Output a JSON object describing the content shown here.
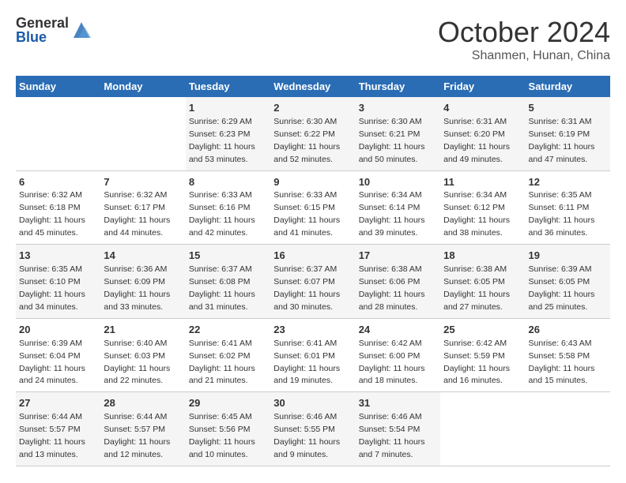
{
  "header": {
    "logo_general": "General",
    "logo_blue": "Blue",
    "title": "October 2024",
    "location": "Shanmen, Hunan, China"
  },
  "days_of_week": [
    "Sunday",
    "Monday",
    "Tuesday",
    "Wednesday",
    "Thursday",
    "Friday",
    "Saturday"
  ],
  "weeks": [
    [
      {
        "day": "",
        "info": ""
      },
      {
        "day": "",
        "info": ""
      },
      {
        "day": "1",
        "sunrise": "6:29 AM",
        "sunset": "6:23 PM",
        "daylight": "11 hours and 53 minutes."
      },
      {
        "day": "2",
        "sunrise": "6:30 AM",
        "sunset": "6:22 PM",
        "daylight": "11 hours and 52 minutes."
      },
      {
        "day": "3",
        "sunrise": "6:30 AM",
        "sunset": "6:21 PM",
        "daylight": "11 hours and 50 minutes."
      },
      {
        "day": "4",
        "sunrise": "6:31 AM",
        "sunset": "6:20 PM",
        "daylight": "11 hours and 49 minutes."
      },
      {
        "day": "5",
        "sunrise": "6:31 AM",
        "sunset": "6:19 PM",
        "daylight": "11 hours and 47 minutes."
      }
    ],
    [
      {
        "day": "6",
        "sunrise": "6:32 AM",
        "sunset": "6:18 PM",
        "daylight": "11 hours and 45 minutes."
      },
      {
        "day": "7",
        "sunrise": "6:32 AM",
        "sunset": "6:17 PM",
        "daylight": "11 hours and 44 minutes."
      },
      {
        "day": "8",
        "sunrise": "6:33 AM",
        "sunset": "6:16 PM",
        "daylight": "11 hours and 42 minutes."
      },
      {
        "day": "9",
        "sunrise": "6:33 AM",
        "sunset": "6:15 PM",
        "daylight": "11 hours and 41 minutes."
      },
      {
        "day": "10",
        "sunrise": "6:34 AM",
        "sunset": "6:14 PM",
        "daylight": "11 hours and 39 minutes."
      },
      {
        "day": "11",
        "sunrise": "6:34 AM",
        "sunset": "6:12 PM",
        "daylight": "11 hours and 38 minutes."
      },
      {
        "day": "12",
        "sunrise": "6:35 AM",
        "sunset": "6:11 PM",
        "daylight": "11 hours and 36 minutes."
      }
    ],
    [
      {
        "day": "13",
        "sunrise": "6:35 AM",
        "sunset": "6:10 PM",
        "daylight": "11 hours and 34 minutes."
      },
      {
        "day": "14",
        "sunrise": "6:36 AM",
        "sunset": "6:09 PM",
        "daylight": "11 hours and 33 minutes."
      },
      {
        "day": "15",
        "sunrise": "6:37 AM",
        "sunset": "6:08 PM",
        "daylight": "11 hours and 31 minutes."
      },
      {
        "day": "16",
        "sunrise": "6:37 AM",
        "sunset": "6:07 PM",
        "daylight": "11 hours and 30 minutes."
      },
      {
        "day": "17",
        "sunrise": "6:38 AM",
        "sunset": "6:06 PM",
        "daylight": "11 hours and 28 minutes."
      },
      {
        "day": "18",
        "sunrise": "6:38 AM",
        "sunset": "6:05 PM",
        "daylight": "11 hours and 27 minutes."
      },
      {
        "day": "19",
        "sunrise": "6:39 AM",
        "sunset": "6:05 PM",
        "daylight": "11 hours and 25 minutes."
      }
    ],
    [
      {
        "day": "20",
        "sunrise": "6:39 AM",
        "sunset": "6:04 PM",
        "daylight": "11 hours and 24 minutes."
      },
      {
        "day": "21",
        "sunrise": "6:40 AM",
        "sunset": "6:03 PM",
        "daylight": "11 hours and 22 minutes."
      },
      {
        "day": "22",
        "sunrise": "6:41 AM",
        "sunset": "6:02 PM",
        "daylight": "11 hours and 21 minutes."
      },
      {
        "day": "23",
        "sunrise": "6:41 AM",
        "sunset": "6:01 PM",
        "daylight": "11 hours and 19 minutes."
      },
      {
        "day": "24",
        "sunrise": "6:42 AM",
        "sunset": "6:00 PM",
        "daylight": "11 hours and 18 minutes."
      },
      {
        "day": "25",
        "sunrise": "6:42 AM",
        "sunset": "5:59 PM",
        "daylight": "11 hours and 16 minutes."
      },
      {
        "day": "26",
        "sunrise": "6:43 AM",
        "sunset": "5:58 PM",
        "daylight": "11 hours and 15 minutes."
      }
    ],
    [
      {
        "day": "27",
        "sunrise": "6:44 AM",
        "sunset": "5:57 PM",
        "daylight": "11 hours and 13 minutes."
      },
      {
        "day": "28",
        "sunrise": "6:44 AM",
        "sunset": "5:57 PM",
        "daylight": "11 hours and 12 minutes."
      },
      {
        "day": "29",
        "sunrise": "6:45 AM",
        "sunset": "5:56 PM",
        "daylight": "11 hours and 10 minutes."
      },
      {
        "day": "30",
        "sunrise": "6:46 AM",
        "sunset": "5:55 PM",
        "daylight": "11 hours and 9 minutes."
      },
      {
        "day": "31",
        "sunrise": "6:46 AM",
        "sunset": "5:54 PM",
        "daylight": "11 hours and 7 minutes."
      },
      {
        "day": "",
        "info": ""
      },
      {
        "day": "",
        "info": ""
      }
    ]
  ],
  "labels": {
    "sunrise": "Sunrise:",
    "sunset": "Sunset:",
    "daylight": "Daylight:"
  }
}
